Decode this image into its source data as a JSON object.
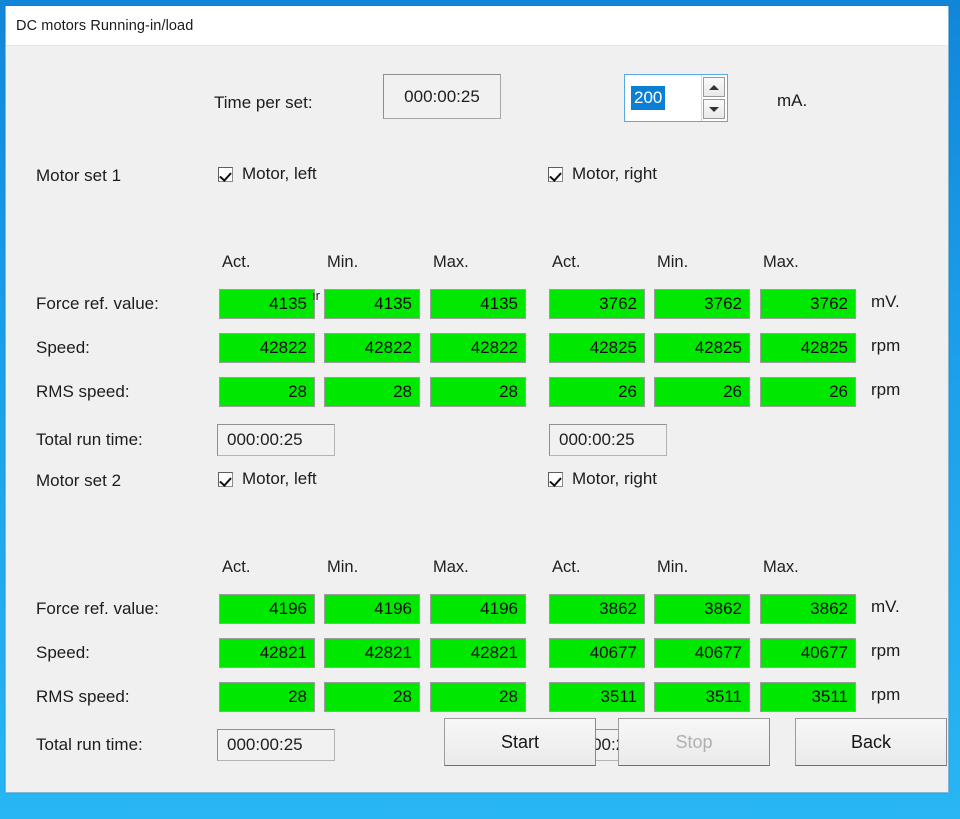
{
  "window": {
    "title": "DC motors Running-in/load"
  },
  "top": {
    "time_per_set_label": "Time per set:",
    "time_per_set_value": "000:00:25",
    "current_value": "200",
    "current_unit": "mA.",
    "spin_up_icon": "triangle-up-icon",
    "spin_down_icon": "triangle-down-icon"
  },
  "columns": [
    "Act.",
    "Min.",
    "Max."
  ],
  "row_labels": {
    "force": "Force ref. value:",
    "speed": "Speed:",
    "rms": "RMS speed:",
    "total": "Total run time:"
  },
  "units": {
    "force": "mV.",
    "speed": "rpm",
    "rms": "rpm"
  },
  "artifact_text": "ır",
  "sets": [
    {
      "name": "Motor set 1",
      "left": {
        "checkbox_label": "Motor, left",
        "checked": true,
        "force": [
          "4135",
          "4135",
          "4135"
        ],
        "speed": [
          "42822",
          "42822",
          "42822"
        ],
        "rms": [
          "28",
          "28",
          "28"
        ],
        "total_run_time": "000:00:25"
      },
      "right": {
        "checkbox_label": "Motor, right",
        "checked": true,
        "force": [
          "3762",
          "3762",
          "3762"
        ],
        "speed": [
          "42825",
          "42825",
          "42825"
        ],
        "rms": [
          "26",
          "26",
          "26"
        ],
        "total_run_time": "000:00:25"
      }
    },
    {
      "name": "Motor set 2",
      "left": {
        "checkbox_label": "Motor, left",
        "checked": true,
        "force": [
          "4196",
          "4196",
          "4196"
        ],
        "speed": [
          "42821",
          "42821",
          "42821"
        ],
        "rms": [
          "28",
          "28",
          "28"
        ],
        "total_run_time": "000:00:25"
      },
      "right": {
        "checkbox_label": "Motor, right",
        "checked": true,
        "force": [
          "3862",
          "3862",
          "3862"
        ],
        "speed": [
          "40677",
          "40677",
          "40677"
        ],
        "rms": [
          "3511",
          "3511",
          "3511"
        ],
        "total_run_time": "000:00:25"
      }
    }
  ],
  "buttons": {
    "start": "Start",
    "stop": "Stop",
    "back": "Back",
    "stop_enabled": false
  },
  "colors": {
    "value_green": "#00e800",
    "window_border_blue": "#1a8fd8",
    "selection_blue": "#0a7fd4",
    "dialog_background": "#f0f0f0"
  }
}
